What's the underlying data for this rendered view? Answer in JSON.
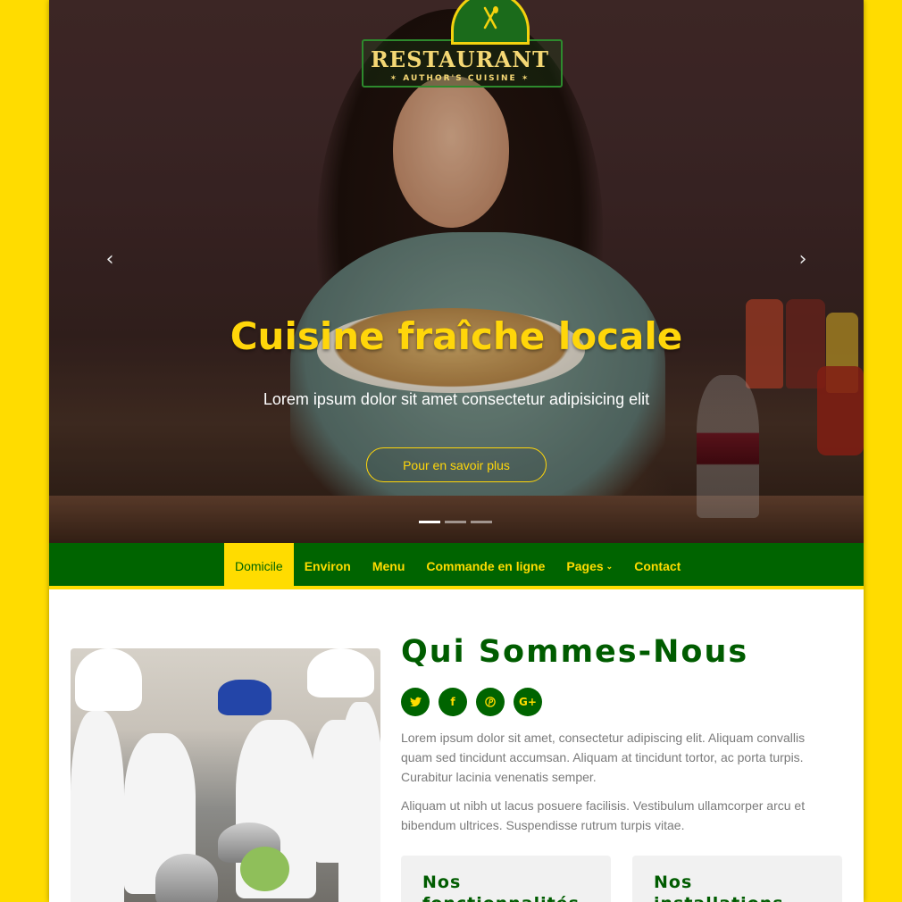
{
  "brand": {
    "logo_title": "RESTAURANT",
    "logo_subtitle": "✶ AUTHOR'S CUISINE ✶",
    "logo_icon": "fork-spoon-icon"
  },
  "colors": {
    "page_background": "#ffdc00",
    "nav_background": "#006400",
    "accent_yellow": "#ffd60a",
    "heading_green": "#005c00",
    "body_text": "#7a7a7a",
    "card_background": "#f1f1f1"
  },
  "hero": {
    "title": "Cuisine fraîche locale",
    "subtitle": "Lorem ipsum dolor sit amet consectetur adipisicing elit",
    "cta_label": "Pour en savoir plus",
    "prev_icon": "chevron-left-icon",
    "next_icon": "chevron-right-icon",
    "prev_glyph": "‹",
    "next_glyph": "›",
    "slide_count": 3,
    "active_slide": 1
  },
  "nav": {
    "items": [
      {
        "label": "Domicile",
        "active": true
      },
      {
        "label": "Environ"
      },
      {
        "label": "Menu"
      },
      {
        "label": "Commande en ligne"
      },
      {
        "label": "Pages",
        "has_dropdown": true
      },
      {
        "label": "Contact"
      }
    ],
    "dropdown_glyph": "⌄"
  },
  "about": {
    "title": "Qui Sommes-Nous",
    "social": [
      {
        "name": "twitter-icon",
        "glyph": "🐦"
      },
      {
        "name": "facebook-icon",
        "glyph": "f"
      },
      {
        "name": "pinterest-icon",
        "glyph": "℗"
      },
      {
        "name": "google-plus-icon",
        "glyph": "G+"
      }
    ],
    "paragraph_1": "Lorem ipsum dolor sit amet, consectetur adipiscing elit. Aliquam convallis quam sed tincidunt accumsan. Aliquam at tincidunt tortor, ac porta turpis. Curabitur lacinia venenatis semper.",
    "paragraph_2": "Aliquam ut nibh ut lacus posuere facilisis. Vestibulum ullamcorper arcu et bibendum ultrices. Suspendisse rutrum turpis vitae.",
    "cards": [
      {
        "title": "Nos fonctionnalités"
      },
      {
        "title": "Nos installations"
      }
    ]
  }
}
